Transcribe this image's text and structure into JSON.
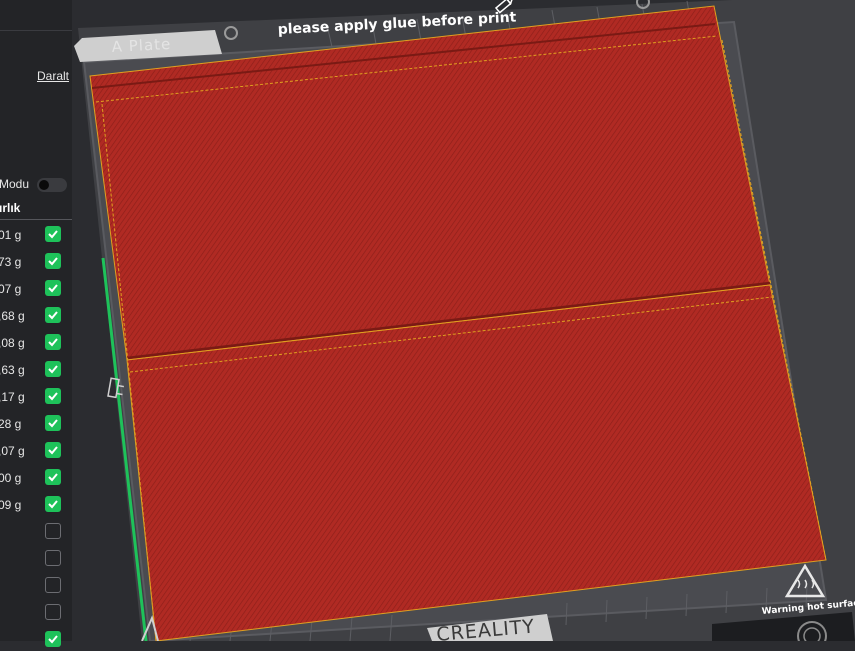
{
  "sidebar": {
    "collapse_label": "Daralt",
    "mode_label": "Modu",
    "mode_toggle_on": false,
    "column_header": "ırlık",
    "filaments": [
      {
        "weight": "01 g",
        "checked": true
      },
      {
        "weight": "73 g",
        "checked": true
      },
      {
        "weight": "07 g",
        "checked": true
      },
      {
        "weight": ",68 g",
        "checked": true
      },
      {
        "weight": ",08 g",
        "checked": true
      },
      {
        "weight": ",63 g",
        "checked": true
      },
      {
        "weight": ",17 g",
        "checked": true
      },
      {
        "weight": "28 g",
        "checked": true
      },
      {
        "weight": ",07 g",
        "checked": true
      },
      {
        "weight": "00 g",
        "checked": true
      },
      {
        "weight": "09 g",
        "checked": true
      },
      {
        "weight": "",
        "checked": false
      },
      {
        "weight": "",
        "checked": false
      },
      {
        "weight": "",
        "checked": false
      },
      {
        "weight": "",
        "checked": false
      },
      {
        "weight": "",
        "checked": true
      }
    ]
  },
  "plate": {
    "name": "A Plate",
    "notice": "please apply glue before print",
    "brand": "CREALITY",
    "warning": "Warning hot surface",
    "model_color": "#b02a23",
    "accent_green": "#1ec25a",
    "bed_color": "#3c3d41"
  }
}
